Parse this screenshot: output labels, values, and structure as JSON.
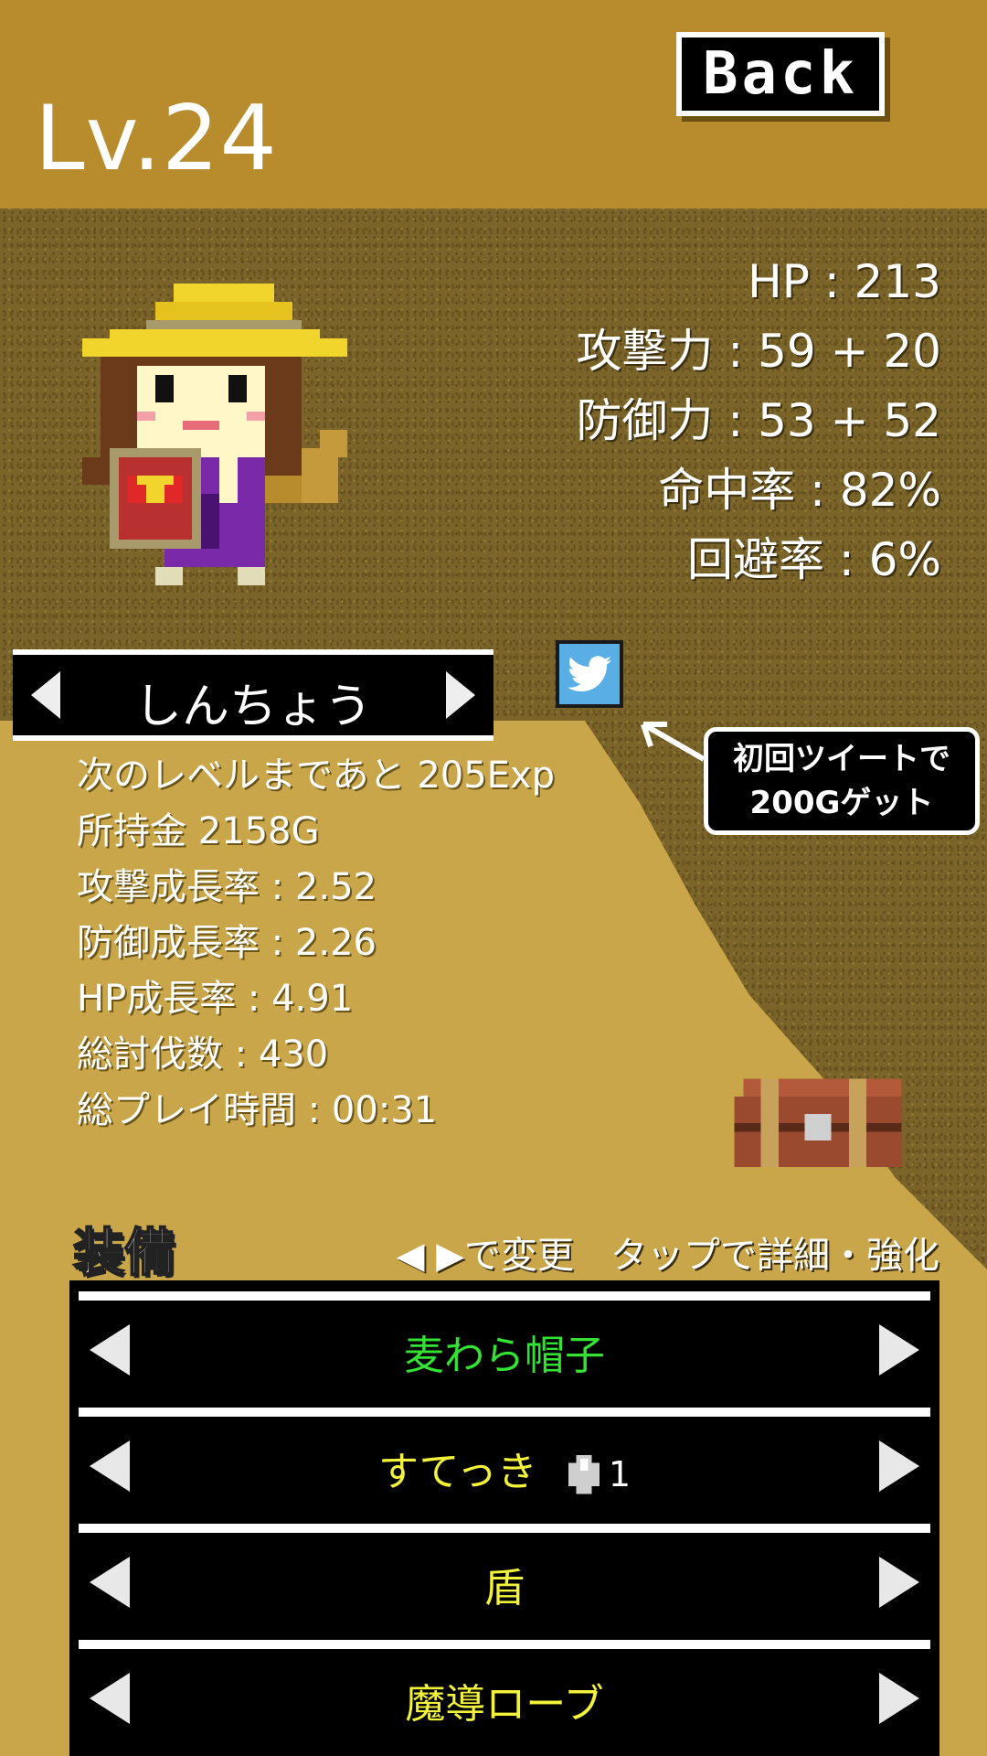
{
  "header": {
    "level": "Lv.24",
    "back_label": "Back"
  },
  "stats": {
    "hp": "HP : 213",
    "attack": "攻撃力 : 59 + 20",
    "defense": "防御力 : 53 + 52",
    "accuracy": "命中率 : 82%",
    "evasion": "回避率 : 6%"
  },
  "character": {
    "name": "しんちょう"
  },
  "twitter": {
    "note_line1": "初回ツイートで",
    "note_line2": "200Gゲット"
  },
  "info": {
    "next_level": "次のレベルまであと 205Exp",
    "money": "所持金 2158G",
    "attack_growth": "攻撃成長率 : 2.52",
    "defense_growth": "防御成長率 : 2.26",
    "hp_growth": "HP成長率 : 4.91",
    "total_kills": "総討伐数 : 430",
    "play_time": "総プレイ時間 : 00:31"
  },
  "equipment": {
    "title": "装備",
    "hint": "◀ ▶で変更　タップで詳細・強化",
    "slots": [
      {
        "name": "麦わら帽子",
        "color": "#33e233"
      },
      {
        "name": "すてっき",
        "color": "#f2f23a",
        "enhance": "1"
      },
      {
        "name": "盾",
        "color": "#f2f23a"
      },
      {
        "name": "魔導ローブ",
        "color": "#f2f23a"
      }
    ]
  },
  "colors": {
    "header_bg": "#b88c2c",
    "panel_bg": "#c9a64a",
    "dirt": "#7a6429",
    "twitter": "#5aaee6"
  }
}
